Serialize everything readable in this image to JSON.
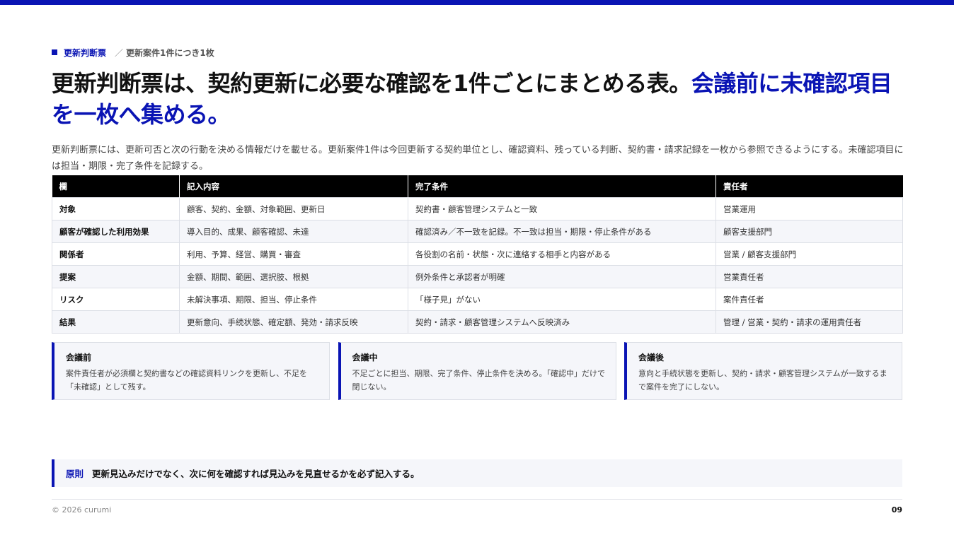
{
  "header": {
    "section": "更新判断票",
    "separator": "／",
    "subsection": "更新案件1件につき1枚"
  },
  "headline": {
    "main": "更新判断票は、契約更新に必要な確認を1件ごとにまとめる表。",
    "accent": "会議前に未確認項目を一枚へ集める。"
  },
  "lede": "更新判断票には、更新可否と次の行動を決める情報だけを載せる。更新案件1件は今回更新する契約単位とし、確認資料、残っている判断、契約書・請求記録を一枚から参照できるようにする。未確認項目には担当・期限・完了条件を記録する。",
  "table": {
    "headers": [
      "欄",
      "記入内容",
      "完了条件",
      "責任者"
    ],
    "rows": [
      [
        "対象",
        "顧客、契約、金額、対象範囲、更新日",
        "契約書・顧客管理システムと一致",
        "営業運用"
      ],
      [
        "顧客が確認した利用効果",
        "導入目的、成果、顧客確認、未達",
        "確認済み／不一致を記録。不一致は担当・期限・停止条件がある",
        "顧客支援部門"
      ],
      [
        "関係者",
        "利用、予算、経営、購買・審査",
        "各役割の名前・状態・次に連絡する相手と内容がある",
        "営業 / 顧客支援部門"
      ],
      [
        "提案",
        "金額、期間、範囲、選択肢、根拠",
        "例外条件と承認者が明確",
        "営業責任者"
      ],
      [
        "リスク",
        "未解決事項、期限、担当、停止条件",
        "「様子見」がない",
        "案件責任者"
      ],
      [
        "結果",
        "更新意向、手続状態、確定額、発効・請求反映",
        "契約・請求・顧客管理システムへ反映済み",
        "管理 / 営業・契約・請求の運用責任者"
      ]
    ]
  },
  "cards": [
    {
      "title": "会議前",
      "body": "案件責任者が必須欄と契約書などの確認資料リンクを更新し、不足を「未確認」として残す。"
    },
    {
      "title": "会議中",
      "body": "不足ごとに担当、期限、完了条件、停止条件を決める。「確認中」だけで閉じない。"
    },
    {
      "title": "会議後",
      "body": "意向と手続状態を更新し、契約・請求・顧客管理システムが一致するまで案件を完了にしない。"
    }
  ],
  "principle": {
    "label": "原則",
    "text": "更新見込みだけでなく、次に何を確認すれば見込みを見直せるかを必ず記入する。"
  },
  "footer": {
    "copyright": "© 2026 curumi",
    "page": "09"
  },
  "colors": {
    "accent": "#0a14b4",
    "table_header_bg": "#000000",
    "panel_bg": "#f5f6fa"
  }
}
